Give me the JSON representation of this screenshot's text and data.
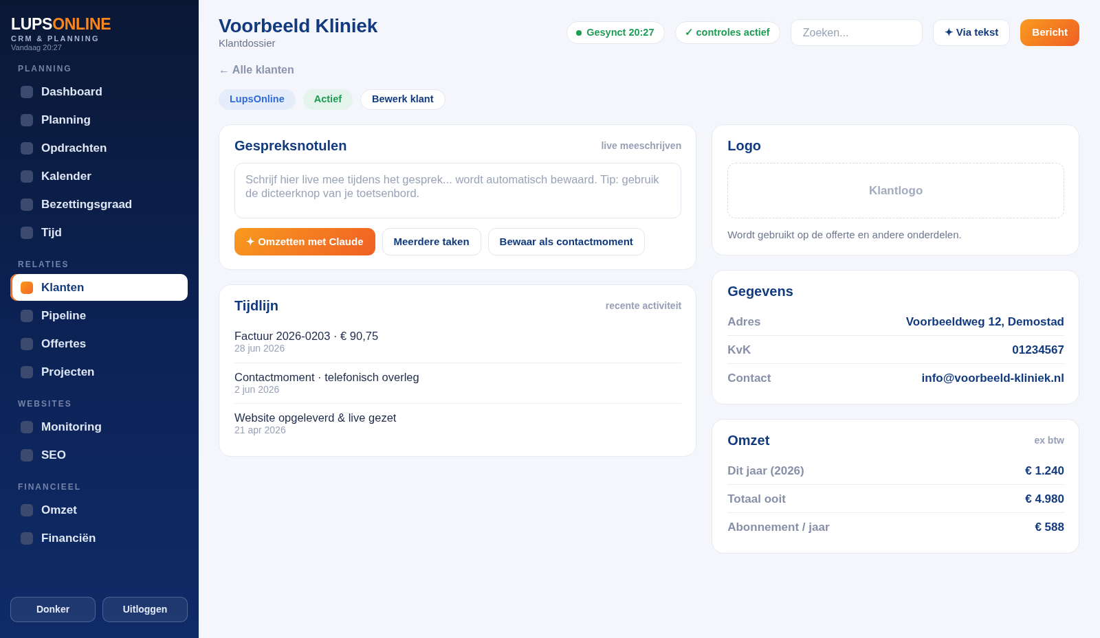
{
  "sidebar": {
    "brand": {
      "lead": "LUPS",
      "accent": "ONLINE"
    },
    "subtitle": "CRM & PLANNING",
    "timestamp": "Vandaag 20:27",
    "sections": [
      {
        "title": "PLANNING",
        "items": [
          {
            "label": "Dashboard",
            "selected": false
          },
          {
            "label": "Planning",
            "selected": false
          },
          {
            "label": "Opdrachten",
            "selected": false
          },
          {
            "label": "Kalender",
            "selected": false
          },
          {
            "label": "Bezettingsgraad",
            "selected": false
          },
          {
            "label": "Tijd",
            "selected": false
          }
        ]
      },
      {
        "title": "RELATIES",
        "items": [
          {
            "label": "Klanten",
            "selected": true
          },
          {
            "label": "Pipeline",
            "selected": false
          },
          {
            "label": "Offertes",
            "selected": false
          },
          {
            "label": "Projecten",
            "selected": false
          }
        ]
      },
      {
        "title": "WEBSITES",
        "items": [
          {
            "label": "Monitoring",
            "selected": false
          },
          {
            "label": "SEO",
            "selected": false
          }
        ]
      },
      {
        "title": "FINANCIEEL",
        "items": [
          {
            "label": "Omzet",
            "selected": false
          },
          {
            "label": "Financiën",
            "selected": false
          }
        ]
      }
    ],
    "footer_buttons": [
      "Donker",
      "Uitloggen"
    ]
  },
  "header": {
    "title": "Voorbeeld Kliniek",
    "subtitle": "Klantdossier",
    "status_pills": [
      {
        "label": "Gesynct 20:27",
        "dot": true,
        "color": "#1f9d55"
      },
      {
        "label": "✓ controles actief",
        "dot": false,
        "color": "#1f9d55"
      }
    ],
    "search": {
      "placeholder": "Zoeken..."
    },
    "buttons": [
      {
        "label": "✦ Via tekst",
        "kind": "outline"
      },
      {
        "label": "Bericht",
        "kind": "primary"
      }
    ]
  },
  "back_link": "← Alle klanten",
  "tags": [
    {
      "label": "LupsOnline",
      "color": "#2f6bd8"
    },
    {
      "label": "Actief",
      "color": "#1f9d55"
    }
  ],
  "edit_button": "Bewerk klant",
  "notes": {
    "title": "Gespreksnotulen",
    "hint": "live meeschrijven",
    "textarea": {
      "placeholder": "Schrijf hier live mee tijdens het gesprek... wordt automatisch bewaard. Tip: gebruik de dicteerknop van je toetsenbord."
    },
    "buttons": [
      {
        "label": "✦ Omzetten met Claude",
        "kind": "primary"
      },
      {
        "label": "Meerdere taken",
        "kind": "outline"
      },
      {
        "label": "Bewaar als contactmoment",
        "kind": "outline"
      }
    ]
  },
  "timeline": {
    "title": "Tijdlijn",
    "hint": "recente activiteit",
    "items": [
      {
        "title": "Factuur 2026-0203 · € 90,75",
        "date": "28 jun 2026"
      },
      {
        "title": "Contactmoment · telefonisch overleg",
        "date": "2 jun 2026"
      },
      {
        "title": "Website opgeleverd & live gezet",
        "date": "21 apr 2026"
      }
    ]
  },
  "logo": {
    "title": "Logo",
    "dropzone": "Klantlogo",
    "caption": "Wordt gebruikt op de offerte en andere onderdelen."
  },
  "details": {
    "title": "Gegevens",
    "rows": [
      {
        "label": "Adres",
        "value": "Voorbeeldweg 12, Demostad"
      },
      {
        "label": "KvK",
        "value": "01234567"
      },
      {
        "label": "Contact",
        "value": "info@voorbeeld-kliniek.nl"
      }
    ]
  },
  "revenue": {
    "title": "Omzet",
    "hint": "ex btw",
    "rows": [
      {
        "label": "Dit jaar (2026)",
        "value": "€ 1.240"
      },
      {
        "label": "Totaal ooit",
        "value": "€ 4.980"
      },
      {
        "label": "Abonnement / jaar",
        "value": "€ 588"
      }
    ]
  }
}
